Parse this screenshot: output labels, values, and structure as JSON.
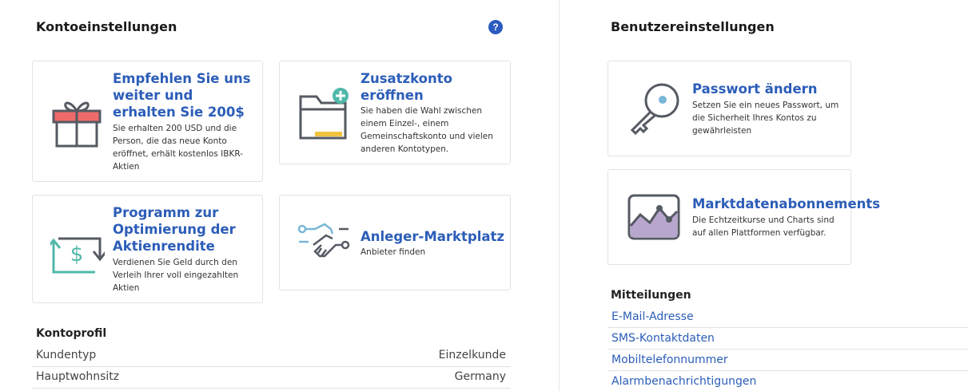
{
  "account_settings": {
    "title": "Kontoeinstellungen",
    "help_label": "?",
    "cards": [
      {
        "title": "Empfehlen Sie uns weiter und erhalten Sie 200$",
        "desc": "Sie erhalten 200 USD und die Person, die das neue Konto eröffnet, erhält kostenlos IBKR-Aktien",
        "icon": "gift-icon"
      },
      {
        "title": "Zusatzkonto eröffnen",
        "desc": "Sie haben die Wahl zwischen einem Einzel-, einem Gemeinschaftskonto und vielen anderen Kontotypen.",
        "icon": "folder-add-icon"
      },
      {
        "title": "Programm zur Optimierung der Aktienrendite",
        "desc": "Verdienen Sie Geld durch den Verleih Ihrer voll eingezahlten Aktien",
        "icon": "dollar-exchange-icon"
      },
      {
        "title": "Anleger-Marktplatz",
        "desc": "Anbieter finden",
        "icon": "handshake-icon"
      }
    ]
  },
  "profile": {
    "title": "Kontoprofil",
    "rows": [
      {
        "key": "Kundentyp",
        "value": "Einzelkunde"
      },
      {
        "key": "Hauptwohnsitz",
        "value": "Germany"
      }
    ]
  },
  "user_settings": {
    "title": "Benutzereinstellungen",
    "cards": [
      {
        "title": "Passwort ändern",
        "desc": "Setzen Sie ein neues Passwort, um die Sicherheit Ihres Kontos zu gewährleisten",
        "icon": "key-icon"
      },
      {
        "title": "Marktdatenabonnements",
        "desc": "Die Echtzeitkurse und Charts sind auf allen Plattformen verfügbar.",
        "icon": "chart-icon"
      }
    ]
  },
  "notifications": {
    "title": "Mitteilungen",
    "links": [
      "E-Mail-Adresse",
      "SMS-Kontaktdaten",
      "Mobiltelefonnummer",
      "Alarmbenachrichtigungen"
    ]
  },
  "colors": {
    "link": "#2c5db8",
    "help_button": "#2c5bbf",
    "accent_teal": "#4fb8a8",
    "accent_red": "#ef6b6b",
    "accent_purple": "#b9a6cf"
  }
}
